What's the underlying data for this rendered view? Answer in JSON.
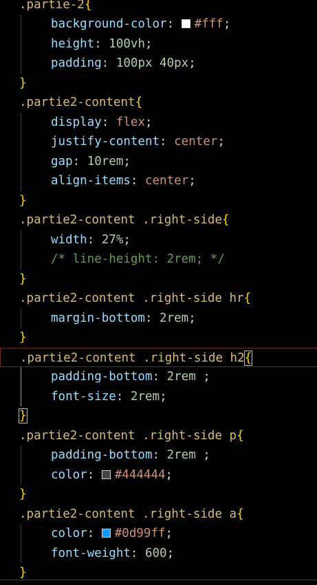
{
  "editor": {
    "lines": [
      {
        "kind": "selector",
        "text": ".partie-2"
      },
      {
        "kind": "decl",
        "prop": "background-color",
        "swatch": "#ffffff",
        "value": "#fff",
        "vclass": "str"
      },
      {
        "kind": "decl",
        "prop": "height",
        "value": "100vh",
        "vclass": "num"
      },
      {
        "kind": "decl",
        "prop": "padding",
        "value": "100px 40px",
        "vclass": "num"
      },
      {
        "kind": "close"
      },
      {
        "kind": "selector",
        "text": ".partie2-content"
      },
      {
        "kind": "decl",
        "prop": "display",
        "value": "flex",
        "vclass": "kw"
      },
      {
        "kind": "decl",
        "prop": "justify-content",
        "value": "center",
        "vclass": "kw"
      },
      {
        "kind": "decl",
        "prop": "gap",
        "value": "10rem",
        "vclass": "num"
      },
      {
        "kind": "decl",
        "prop": "align-items",
        "value": "center",
        "vclass": "kw"
      },
      {
        "kind": "close"
      },
      {
        "kind": "selector",
        "text": ".partie2-content .right-side"
      },
      {
        "kind": "decl",
        "prop": "width",
        "value": "27%",
        "vclass": "num"
      },
      {
        "kind": "comment",
        "text": "/* line-height: 2rem; */"
      },
      {
        "kind": "close"
      },
      {
        "kind": "selector",
        "text": ".partie2-content .right-side hr"
      },
      {
        "kind": "decl",
        "prop": "margin-bottom",
        "value": "2rem",
        "vclass": "num"
      },
      {
        "kind": "close"
      },
      {
        "kind": "selector",
        "text": ".partie2-content .right-side h2",
        "current": true
      },
      {
        "kind": "decl",
        "prop": "padding-bottom",
        "value": "2rem ",
        "vclass": "num"
      },
      {
        "kind": "decl",
        "prop": "font-size",
        "value": "2rem",
        "vclass": "num"
      },
      {
        "kind": "close",
        "active": true
      },
      {
        "kind": "selector",
        "text": ".partie2-content .right-side p"
      },
      {
        "kind": "decl",
        "prop": "padding-bottom",
        "value": "2rem ",
        "vclass": "num"
      },
      {
        "kind": "decl",
        "prop": "color",
        "swatch": "#444444",
        "value": "#444444",
        "vclass": "str"
      },
      {
        "kind": "close"
      },
      {
        "kind": "selector",
        "text": ".partie2-content .right-side a"
      },
      {
        "kind": "decl",
        "prop": "color",
        "swatch": "#0d99ff",
        "value": "#0d99ff",
        "vclass": "str"
      },
      {
        "kind": "decl",
        "prop": "font-weight",
        "value": "600",
        "vclass": "num"
      },
      {
        "kind": "close"
      }
    ]
  }
}
